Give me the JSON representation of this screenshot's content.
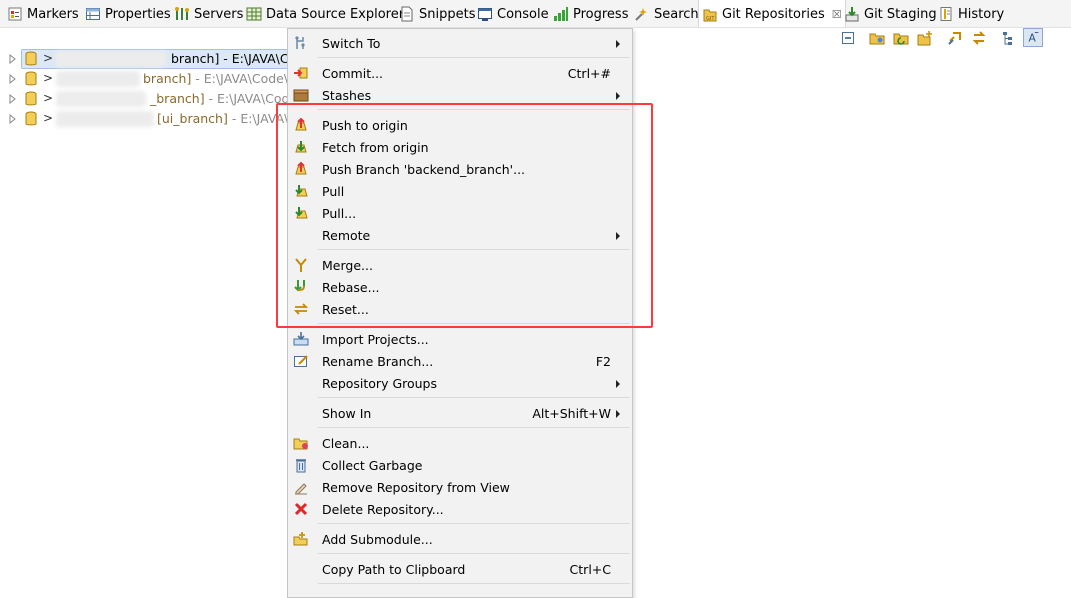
{
  "tabs": [
    {
      "label": "Markers",
      "icon": "markers-icon"
    },
    {
      "label": "Properties",
      "icon": "properties-icon"
    },
    {
      "label": "Servers",
      "icon": "servers-icon"
    },
    {
      "label": "Data Source Explorer",
      "icon": "data-source-explorer-icon"
    },
    {
      "label": "Snippets",
      "icon": "snippets-icon"
    },
    {
      "label": "Console",
      "icon": "console-icon"
    },
    {
      "label": "Progress",
      "icon": "progress-icon"
    },
    {
      "label": "Search",
      "icon": "search-icon"
    },
    {
      "label": "Git Repositories",
      "icon": "git-repositories-icon",
      "active": true,
      "close": "☒"
    },
    {
      "label": "Git Staging",
      "icon": "git-staging-icon"
    },
    {
      "label": "History",
      "icon": "history-icon"
    }
  ],
  "toolbar": [
    "collapse-all-icon",
    "add-existing-repo-icon",
    "clone-repo-icon",
    "create-repo-icon",
    "link-with-selection-icon",
    "sync-icon",
    "tree-view-icon",
    "view-menu-icon"
  ],
  "tree": {
    "prefix": ">",
    "rows": [
      {
        "branch": "branch]",
        "path": " - E:\\JAVA\\Co",
        "selected": true
      },
      {
        "branch": "branch]",
        "path": " - E:\\JAVA\\Code\\"
      },
      {
        "branch": "_branch]",
        "path": " - E:\\JAVA\\Cod"
      },
      {
        "branch": "[ui_branch]",
        "path": " - E:\\JAVA\\Co"
      }
    ]
  },
  "menu": {
    "items": [
      {
        "label": "Switch To",
        "icon": "switch-to-icon",
        "submenu": true
      },
      {
        "label": "Commit...",
        "icon": "commit-icon",
        "shortcut": "Ctrl+#"
      },
      {
        "label": "Stashes",
        "icon": "stashes-icon",
        "submenu": true
      },
      {
        "label": "Push to origin",
        "icon": "push-to-origin-icon"
      },
      {
        "label": "Fetch from origin",
        "icon": "fetch-from-origin-icon"
      },
      {
        "label": "Push Branch 'backend_branch'...",
        "icon": "push-branch-icon"
      },
      {
        "label": "Pull",
        "icon": "pull-icon"
      },
      {
        "label": "Pull...",
        "icon": "pull-dialog-icon"
      },
      {
        "label": "Remote",
        "icon": "",
        "submenu": true
      },
      {
        "label": "Merge...",
        "icon": "merge-icon"
      },
      {
        "label": "Rebase...",
        "icon": "rebase-icon"
      },
      {
        "label": "Reset...",
        "icon": "reset-icon"
      },
      {
        "label": "Import Projects...",
        "icon": "import-projects-icon"
      },
      {
        "label": "Rename Branch...",
        "icon": "rename-branch-icon",
        "shortcut": "F2"
      },
      {
        "label": "Repository Groups",
        "icon": "",
        "submenu": true
      },
      {
        "label": "Show In",
        "icon": "",
        "shortcut": "Alt+Shift+W",
        "submenu": true
      },
      {
        "label": "Clean...",
        "icon": "clean-icon"
      },
      {
        "label": "Collect Garbage",
        "icon": "collect-garbage-icon"
      },
      {
        "label": "Remove Repository from View",
        "icon": "remove-repository-icon"
      },
      {
        "label": "Delete Repository...",
        "icon": "delete-repository-icon"
      },
      {
        "label": "Add Submodule...",
        "icon": "add-submodule-icon"
      },
      {
        "label": "Copy Path to Clipboard",
        "icon": "copy-path-icon",
        "shortcut": "Ctrl+C"
      }
    ]
  },
  "colors": {
    "highlight_box": "#ff3a3a",
    "menu_bg": "#f2f2f2",
    "selection_bg": "#dde8f6",
    "path_gray": "#8b8b8b",
    "branch_brown": "#8a6a2d"
  }
}
